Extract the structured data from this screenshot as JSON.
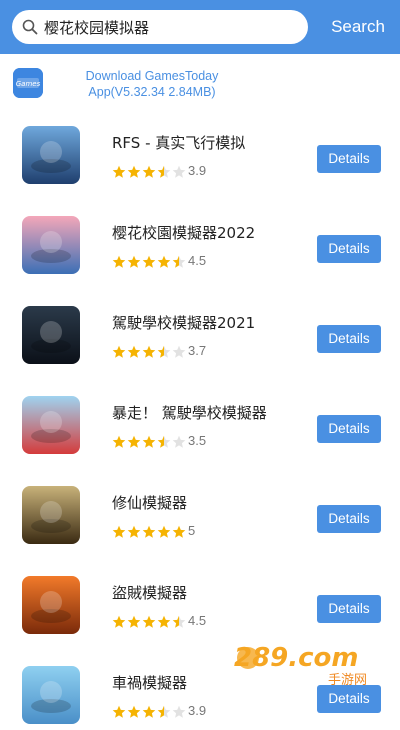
{
  "search": {
    "query": "樱花校园模拟器",
    "button_label": "Search"
  },
  "promo": {
    "line1": "Download GamesToday",
    "line2": "App(V5.32.34  2.84MB)",
    "logo_text": "Games"
  },
  "apps": [
    {
      "name": "RFS - 真实飞行模拟",
      "rating": "3.9",
      "stars": 3.5,
      "button": "Details",
      "icon": "airplane-icon",
      "colors": [
        "#6fa8dc",
        "#1f3f6e"
      ]
    },
    {
      "name": "樱花校園模擬器2022",
      "rating": "4.5",
      "stars": 4.5,
      "button": "Details",
      "icon": "anime-girl-icon",
      "colors": [
        "#f4a7b9",
        "#3b6fb5"
      ]
    },
    {
      "name": "駕駛學校模擬器2021",
      "rating": "3.7",
      "stars": 3.5,
      "button": "Details",
      "icon": "driving-car-icon",
      "colors": [
        "#2b3a4a",
        "#0b1018"
      ]
    },
    {
      "name": "暴走！ 駕駛學校模擬器",
      "rating": "3.5",
      "stars": 3.5,
      "button": "Details",
      "icon": "anime-car-icon",
      "colors": [
        "#9fd3f0",
        "#d43b3b"
      ]
    },
    {
      "name": "修仙模擬器",
      "rating": "5",
      "stars": 5,
      "button": "Details",
      "icon": "warrior-icon",
      "colors": [
        "#c8b27a",
        "#3a2a12"
      ]
    },
    {
      "name": "盜賊模擬器",
      "rating": "4.5",
      "stars": 4.5,
      "button": "Details",
      "icon": "thief-icon",
      "colors": [
        "#f27a2a",
        "#7a2a0a"
      ]
    },
    {
      "name": "車禍模擬器",
      "rating": "3.9",
      "stars": 3.5,
      "button": "Details",
      "icon": "crash-car-icon",
      "colors": [
        "#8fd0f0",
        "#4a8fc8"
      ]
    }
  ],
  "watermark": {
    "text": "289.com",
    "subtext": "手游网"
  },
  "colors": {
    "accent": "#4a90e2",
    "star_filled": "#f5b301",
    "star_empty": "#e2e2e2"
  }
}
